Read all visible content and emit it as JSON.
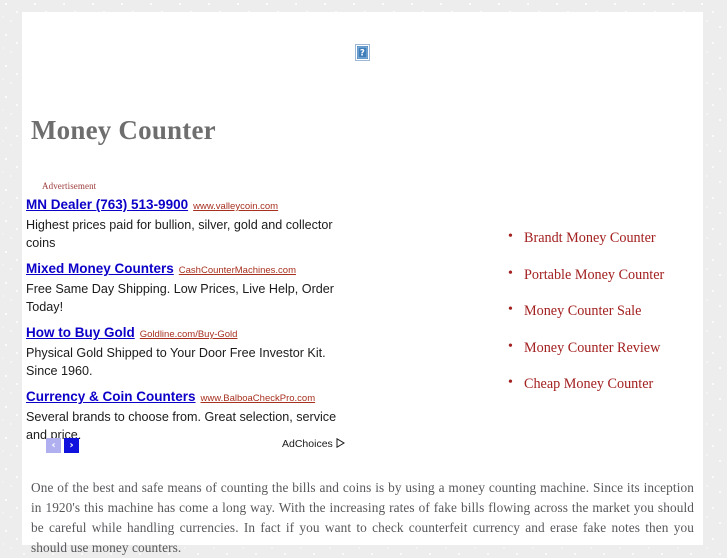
{
  "page": {
    "title": "Money Counter",
    "broken_image_icon": "broken-image-placeholder-icon"
  },
  "ads": {
    "label": "Advertisement",
    "items": [
      {
        "title": "MN Dealer (763) 513-9900",
        "url": "www.valleycoin.com",
        "description": "Highest prices paid for bullion, silver, gold and collector coins"
      },
      {
        "title": "Mixed Money Counters",
        "url": "CashCounterMachines.com",
        "description": "Free Same Day Shipping. Low Prices, Live Help, Order Today!"
      },
      {
        "title": "How to Buy Gold",
        "url": "Goldline.com/Buy-Gold",
        "description": "Physical Gold Shipped to Your Door Free Investor Kit. Since 1960."
      },
      {
        "title": "Currency & Coin Counters",
        "url": "www.BalboaCheckPro.com",
        "description": "Several brands to choose from. Great selection, service and price."
      }
    ],
    "footer": {
      "prev_label": "‹",
      "next_label": "›",
      "adchoices_label": "AdChoices",
      "adchoices_icon": "adchoices-triangle-icon"
    }
  },
  "related": {
    "items": [
      {
        "label": "Brandt Money Counter"
      },
      {
        "label": "Portable Money Counter"
      },
      {
        "label": "Money Counter Sale"
      },
      {
        "label": "Money Counter Review"
      },
      {
        "label": "Cheap Money Counter"
      }
    ]
  },
  "article": {
    "paragraph": "One of the best and safe means of counting the bills and coins is by using a money counting machine. Since its inception in 1920's this machine has come a long way. With the increasing rates of fake bills flowing across the market you should be careful while handling currencies. In fact if you want to check counterfeit currency and erase fake notes then you should use money counters."
  },
  "colors": {
    "ad_title": "#0c00c8",
    "ad_url": "#a7301f",
    "related_link": "#a32020",
    "heading": "#6e6e6e",
    "body_text": "#58585c",
    "nav_next": "#1111dd",
    "nav_prev": "#b0b0f0"
  }
}
